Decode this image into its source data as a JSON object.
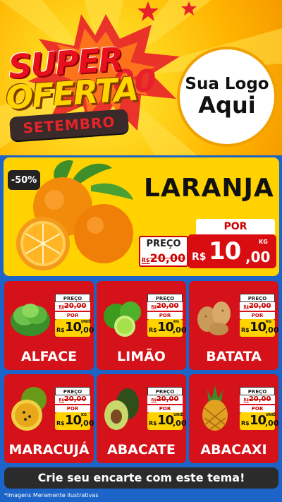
{
  "colors": {
    "header_yellow": "#ffd21a",
    "promo_red": "#d51119",
    "background_blue": "#1c64c8",
    "price_yellow": "#ffd200"
  },
  "header": {
    "title_line1": "SUPER",
    "title_line2": "OFERTA",
    "subtitle": "SETEMBRO",
    "logo_line1": "Sua Logo",
    "logo_line2": "Aqui"
  },
  "hero": {
    "discount": "-50%",
    "product": "LARANJA",
    "preco_label": "PREÇO",
    "old_currency": "R$",
    "old_price": "20,00",
    "por_label": "POR",
    "currency": "R$",
    "price_int": "10",
    "price_cents": ",00",
    "unit": "KG",
    "icon": "orange-fruit-icon"
  },
  "products": [
    {
      "name": "ALFACE",
      "unit": "UNID",
      "icon": "lettuce-icon"
    },
    {
      "name": "LIMÃO",
      "unit": "KG",
      "icon": "lime-icon"
    },
    {
      "name": "BATATA",
      "unit": "KG",
      "icon": "potato-icon"
    },
    {
      "name": "MARACUJÁ",
      "unit": "KG",
      "icon": "passion-fruit-icon"
    },
    {
      "name": "ABACATE",
      "unit": "UNID",
      "icon": "avocado-icon"
    },
    {
      "name": "ABACAXI",
      "unit": "UNID",
      "icon": "pineapple-icon"
    }
  ],
  "card_price": {
    "preco_label": "PREÇO",
    "old_currency": "R$",
    "old_price": "20,00",
    "por_label": "POR",
    "currency": "R$",
    "price_int": "10",
    "price_cents": ",00"
  },
  "footer": {
    "cta": "Crie seu encarte com este tema!",
    "note": "*Imagens Meramente Ilustrativas"
  }
}
